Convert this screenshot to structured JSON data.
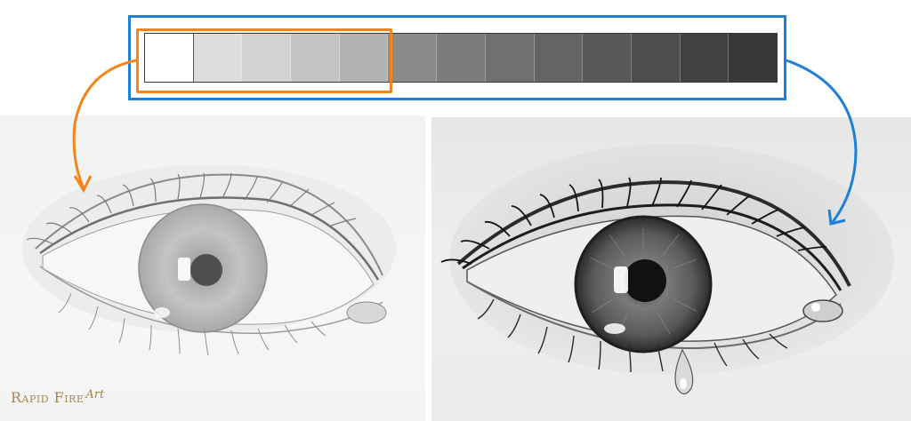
{
  "logo": {
    "main_text": "Rapid Fire",
    "accent_text": "Art"
  },
  "value_scale": {
    "steps": 13,
    "swatch_colors": [
      "#ffffff",
      "#dddddd",
      "#d2d2d2",
      "#c4c4c4",
      "#b2b2b2",
      "#8a8a8a",
      "#7c7c7c",
      "#707070",
      "#646464",
      "#585858",
      "#4d4d4d",
      "#424242",
      "#383838"
    ],
    "highlighted_range": [
      1,
      5
    ]
  },
  "colors": {
    "highlight": "#f2861b",
    "frame": "#1f7fd6"
  },
  "images": {
    "left": "light-pencil-eye-drawing",
    "right": "dark-shaded-eye-drawing-with-tear"
  }
}
